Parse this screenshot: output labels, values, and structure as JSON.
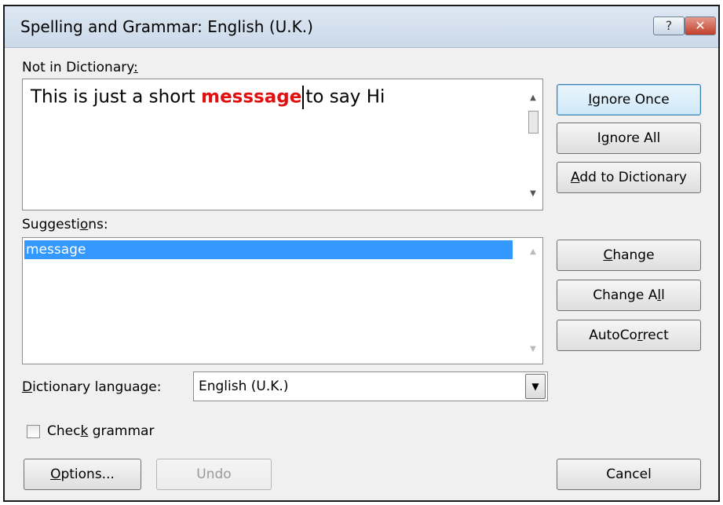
{
  "window": {
    "title": "Spelling and Grammar: English (U.K.)",
    "help_glyph": "?",
    "close_glyph": "✕"
  },
  "not_in_dictionary": {
    "label_pre": "Not in Dictionary",
    "label_hot": ":",
    "text_before": "This is just a short ",
    "error_word": "messsage",
    "text_after": "to say Hi",
    "error_color": "#e01010"
  },
  "suggestions": {
    "label_pre": "Suggesti",
    "label_hot": "o",
    "label_post": "ns:",
    "items": [
      "message"
    ],
    "selected_color": "#3399ff"
  },
  "buttons": {
    "ignore_once": {
      "hot": "I",
      "rest": "gnore Once"
    },
    "ignore_all": {
      "pre": "I",
      "hot": "g",
      "rest": "nore All"
    },
    "add_to_dictionary": {
      "hot": "A",
      "rest": "dd to Dictionary"
    },
    "change": {
      "hot": "C",
      "rest": "hange"
    },
    "change_all": {
      "pre": "Change A",
      "hot": "l",
      "rest": "l"
    },
    "autocorrect": {
      "pre": "AutoCo",
      "hot": "r",
      "rest": "rect"
    },
    "options": {
      "hot": "O",
      "rest": "ptions..."
    },
    "undo": "Undo",
    "cancel": "Cancel"
  },
  "dictionary_language": {
    "label_hot": "D",
    "label_rest": "ictionary language:",
    "value": "English (U.K.)"
  },
  "check_grammar": {
    "label_pre": "Chec",
    "label_hot": "k",
    "label_post": " grammar",
    "checked": false
  },
  "icons": {
    "scroll_up": "▲",
    "scroll_down": "▼",
    "dropdown": "▼"
  }
}
